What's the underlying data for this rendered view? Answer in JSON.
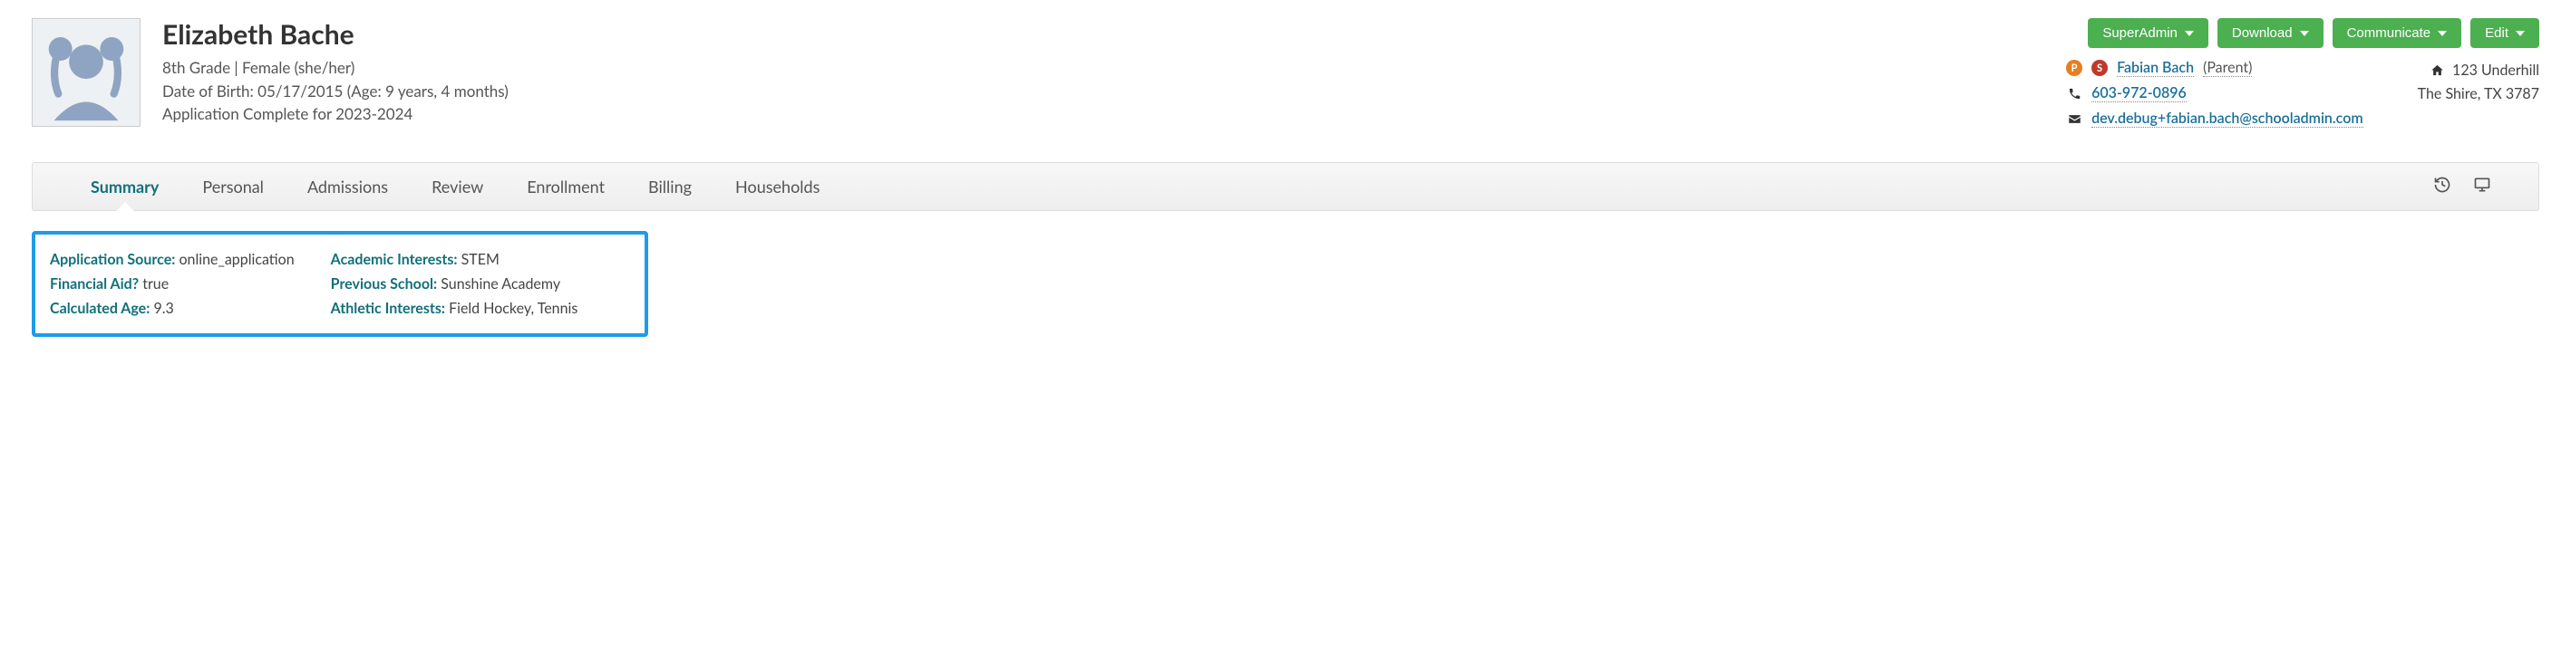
{
  "profile": {
    "name": "Elizabeth Bache",
    "grade_gender": "8th Grade | Female (she/her)",
    "dob_line": "Date of Birth: 05/17/2015 (Age: 9 years, 4 months)",
    "status_line": "Application Complete for 2023-2024"
  },
  "buttons": {
    "superadmin": "SuperAdmin",
    "download": "Download",
    "communicate": "Communicate",
    "edit": "Edit"
  },
  "contact": {
    "badge_p": "P",
    "badge_s": "S",
    "name": "Fabian Bach",
    "relation": "(Parent)",
    "phone": "603-972-0896",
    "email": "dev.debug+fabian.bach@schooladmin.com"
  },
  "address": {
    "line1": "123 Underhill",
    "line2": "The Shire, TX 3787"
  },
  "tabs": {
    "summary": "Summary",
    "personal": "Personal",
    "admissions": "Admissions",
    "review": "Review",
    "enrollment": "Enrollment",
    "billing": "Billing",
    "households": "Households"
  },
  "summary": {
    "app_source_label": "Application Source:",
    "app_source_value": "online_application",
    "fin_aid_label": "Financial Aid?",
    "fin_aid_value": "true",
    "calc_age_label": "Calculated Age:",
    "calc_age_value": "9.3",
    "acad_int_label": "Academic Interests:",
    "acad_int_value": "STEM",
    "prev_school_label": "Previous School:",
    "prev_school_value": "Sunshine Academy",
    "ath_int_label": "Athletic Interests:",
    "ath_int_value": "Field Hockey, Tennis"
  }
}
